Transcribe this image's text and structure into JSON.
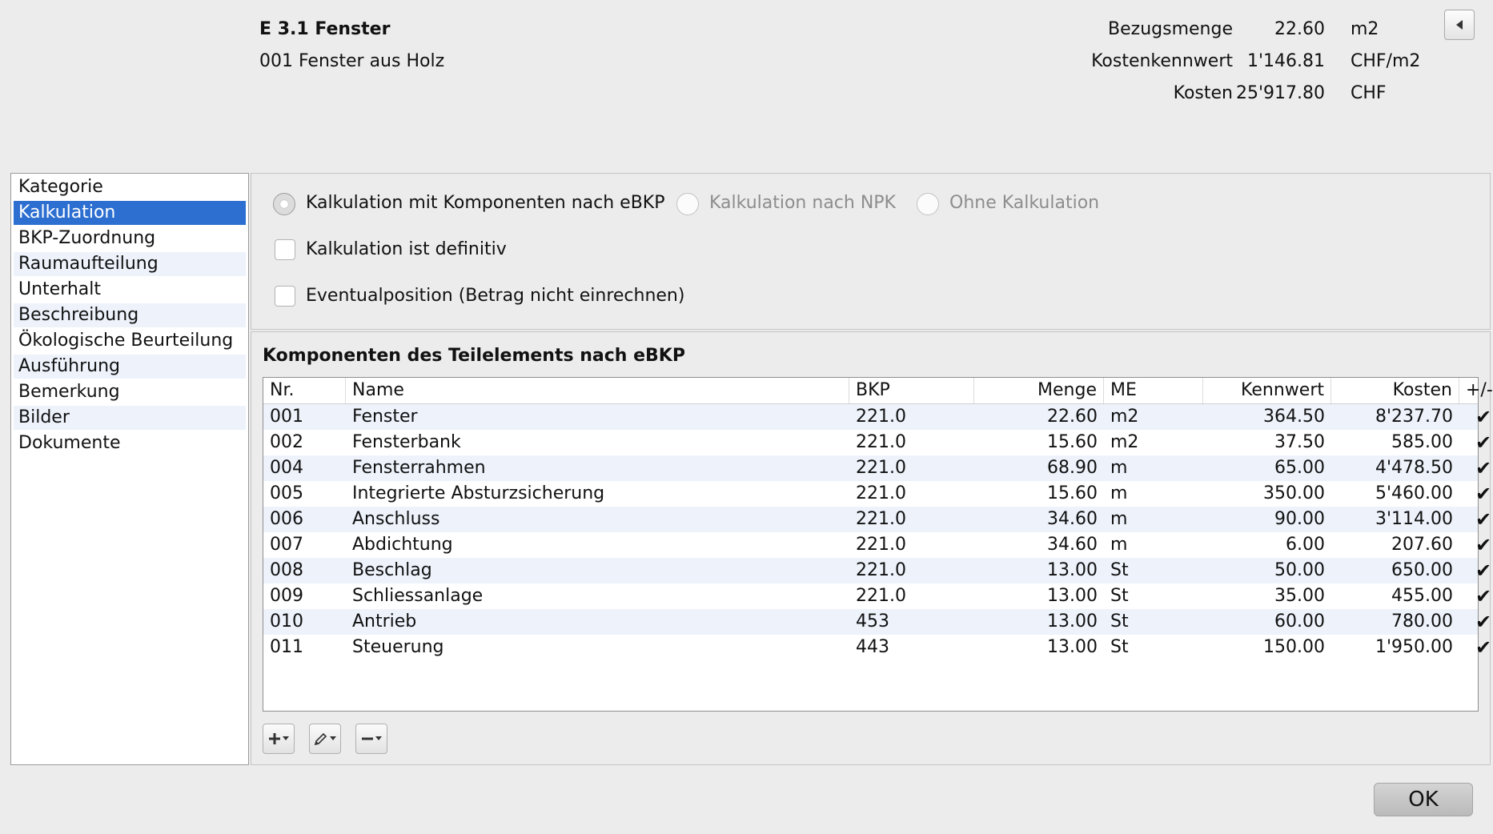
{
  "header": {
    "title": "E 3.1 Fenster",
    "subtitle": "001 Fenster aus Holz",
    "rows": [
      {
        "label": "Bezugsmenge",
        "value": "22.60",
        "unit": "m2"
      },
      {
        "label": "Kostenkennwert",
        "value": "1'146.81",
        "unit": "CHF/m2"
      },
      {
        "label": "Kosten",
        "value": "25'917.80",
        "unit": "CHF"
      }
    ],
    "collapse_icon": "triangle-left-icon"
  },
  "sidebar": {
    "items": [
      {
        "label": "Kategorie"
      },
      {
        "label": "Kalkulation"
      },
      {
        "label": "BKP-Zuordnung"
      },
      {
        "label": "Raumaufteilung"
      },
      {
        "label": "Unterhalt"
      },
      {
        "label": "Beschreibung"
      },
      {
        "label": "Ökologische Beurteilung"
      },
      {
        "label": "Ausführung"
      },
      {
        "label": "Bemerkung"
      },
      {
        "label": "Bilder"
      },
      {
        "label": "Dokumente"
      }
    ],
    "selected": "Kalkulation"
  },
  "options": {
    "radio1": "Kalkulation mit Komponenten nach eBKP",
    "radio2": "Kalkulation nach NPK",
    "radio3": "Ohne Kalkulation",
    "check1": "Kalkulation ist definitiv",
    "check2": "Eventualposition (Betrag nicht einrechnen)"
  },
  "components": {
    "title": "Komponenten des Teilelements nach eBKP",
    "columns": {
      "nr": "Nr.",
      "name": "Name",
      "bkp": "BKP",
      "menge": "Menge",
      "me": "ME",
      "kennwert": "Kennwert",
      "kosten": "Kosten",
      "pm": "+/-"
    },
    "rows": [
      {
        "nr": "001",
        "name": "Fenster",
        "bkp": "221.0",
        "menge": "22.60",
        "me": "m2",
        "kennwert": "364.50",
        "kosten": "8'237.70",
        "pm": "✔"
      },
      {
        "nr": "002",
        "name": "Fensterbank",
        "bkp": "221.0",
        "menge": "15.60",
        "me": "m2",
        "kennwert": "37.50",
        "kosten": "585.00",
        "pm": "✔"
      },
      {
        "nr": "004",
        "name": "Fensterrahmen",
        "bkp": "221.0",
        "menge": "68.90",
        "me": "m",
        "kennwert": "65.00",
        "kosten": "4'478.50",
        "pm": "✔"
      },
      {
        "nr": "005",
        "name": "Integrierte Absturzsicherung",
        "bkp": "221.0",
        "menge": "15.60",
        "me": "m",
        "kennwert": "350.00",
        "kosten": "5'460.00",
        "pm": "✔"
      },
      {
        "nr": "006",
        "name": "Anschluss",
        "bkp": "221.0",
        "menge": "34.60",
        "me": "m",
        "kennwert": "90.00",
        "kosten": "3'114.00",
        "pm": "✔"
      },
      {
        "nr": "007",
        "name": "Abdichtung",
        "bkp": "221.0",
        "menge": "34.60",
        "me": "m",
        "kennwert": "6.00",
        "kosten": "207.60",
        "pm": "✔"
      },
      {
        "nr": "008",
        "name": "Beschlag",
        "bkp": "221.0",
        "menge": "13.00",
        "me": "St",
        "kennwert": "50.00",
        "kosten": "650.00",
        "pm": "✔"
      },
      {
        "nr": "009",
        "name": "Schliessanlage",
        "bkp": "221.0",
        "menge": "13.00",
        "me": "St",
        "kennwert": "35.00",
        "kosten": "455.00",
        "pm": "✔"
      },
      {
        "nr": "010",
        "name": "Antrieb",
        "bkp": "453",
        "menge": "13.00",
        "me": "St",
        "kennwert": "60.00",
        "kosten": "780.00",
        "pm": "✔"
      },
      {
        "nr": "011",
        "name": "Steuerung",
        "bkp": "443",
        "menge": "13.00",
        "me": "St",
        "kennwert": "150.00",
        "kosten": "1'950.00",
        "pm": "✔"
      }
    ]
  },
  "toolbar": {
    "add_icon": "plus-icon",
    "edit_icon": "pencil-icon",
    "remove_icon": "minus-icon"
  },
  "footer": {
    "ok_label": "OK"
  },
  "colors": {
    "selection": "#2d6fd1",
    "alt_row": "#edf2fb"
  }
}
